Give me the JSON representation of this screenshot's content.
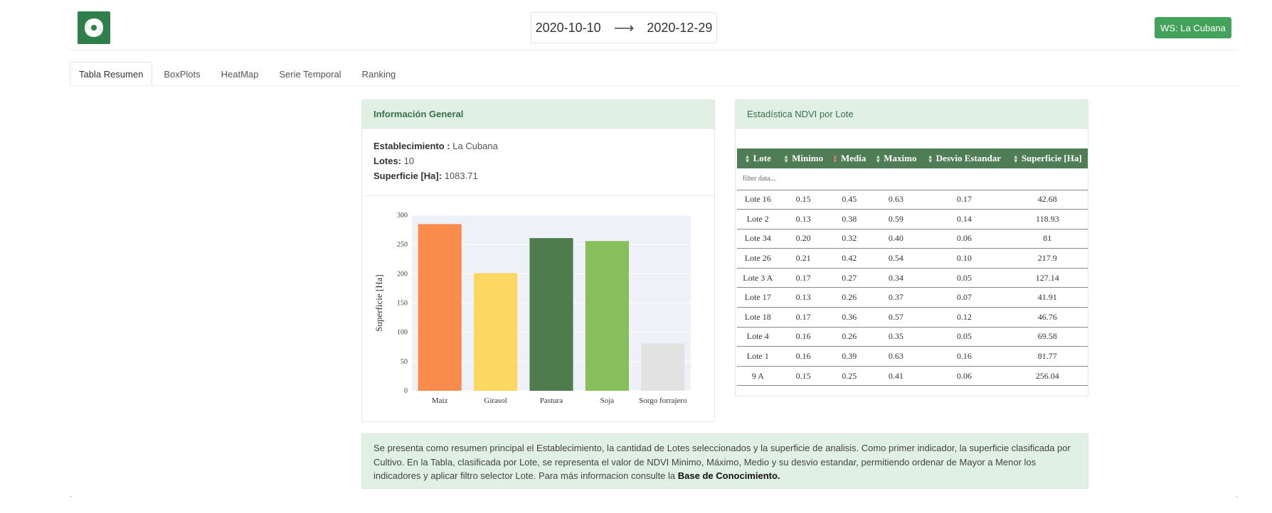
{
  "header": {
    "logo_icon": "swirl-logo-icon",
    "date_from": "2020-10-10",
    "arrow": "⟶",
    "date_to": "2020-12-29",
    "ws_button": "WS: La Cubana",
    "accent": "#43a35c"
  },
  "tabs": [
    {
      "label": "Tabla Resumen",
      "active": true
    },
    {
      "label": "BoxPlots"
    },
    {
      "label": "HeatMap"
    },
    {
      "label": "Serie Temporal"
    },
    {
      "label": "Ranking"
    }
  ],
  "info": {
    "title": "Información General",
    "establecimiento_label": "Establecimiento :",
    "establecimiento_value": "La Cubana",
    "lotes_label": "Lotes:",
    "lotes_value": "10",
    "superficie_label": "Superficie [Ha]:",
    "superficie_value": "1083.71"
  },
  "chart_data": {
    "type": "bar",
    "categories": [
      "Maíz",
      "Girasol",
      "Pastura",
      "Soja",
      "Sorgo forrajero"
    ],
    "values": [
      285,
      201,
      261,
      256,
      81
    ],
    "colors": [
      "#fa8d4e",
      "#fcd762",
      "#4e7c4c",
      "#86bf5b",
      "#e2e2e2"
    ],
    "ylabel": "Superficie [Ha]",
    "ylim": [
      0,
      300
    ],
    "yticks": [
      0,
      50,
      100,
      150,
      200,
      250,
      300
    ],
    "grid": true
  },
  "stats": {
    "title": "Estadística NDVI por Lote",
    "columns": [
      "Lote",
      "Minimo",
      "Media",
      "Maximo",
      "Desvio Estandar",
      "Superficie [Ha]"
    ],
    "filter_placeholder": "filter data...",
    "rows": [
      [
        "Lote 16",
        "0.15",
        "0.45",
        "0.63",
        "0.17",
        "42.68"
      ],
      [
        "Lote 2",
        "0.13",
        "0.38",
        "0.59",
        "0.14",
        "118.93"
      ],
      [
        "Lote 34",
        "0.20",
        "0.32",
        "0.40",
        "0.06",
        "81"
      ],
      [
        "Lote 26",
        "0.21",
        "0.42",
        "0.54",
        "0.10",
        "217.9"
      ],
      [
        "Lote 3 A",
        "0.17",
        "0.27",
        "0.34",
        "0.05",
        "127.14"
      ],
      [
        "Lote 17",
        "0.13",
        "0.26",
        "0.37",
        "0.07",
        "41.91"
      ],
      [
        "Lote 18",
        "0.17",
        "0.36",
        "0.57",
        "0.12",
        "46.76"
      ],
      [
        "Lote 4",
        "0.16",
        "0.26",
        "0.35",
        "0.05",
        "69.58"
      ],
      [
        "Lote 1",
        "0.16",
        "0.39",
        "0.63",
        "0.16",
        "81.77"
      ],
      [
        "9 A",
        "0.15",
        "0.25",
        "0.41",
        "0.06",
        "256.04"
      ]
    ]
  },
  "note": {
    "text": "Se presenta como resumen principal el Establecimiento, la cantidad de Lotes seleccionados y la superficie de analisis. Como primer indicador, la superficie clasificada por Cultivo. En la Tabla, clasificada por Lote, se representa el valor de NDVI Minimo, Máximo, Medio y su desvio estandar, permitiendo ordenar de Mayor a Menor los indicadores y aplicar filtro selector Lote. Para más informacion consulte la",
    "link": "Base de Conocimiento."
  }
}
